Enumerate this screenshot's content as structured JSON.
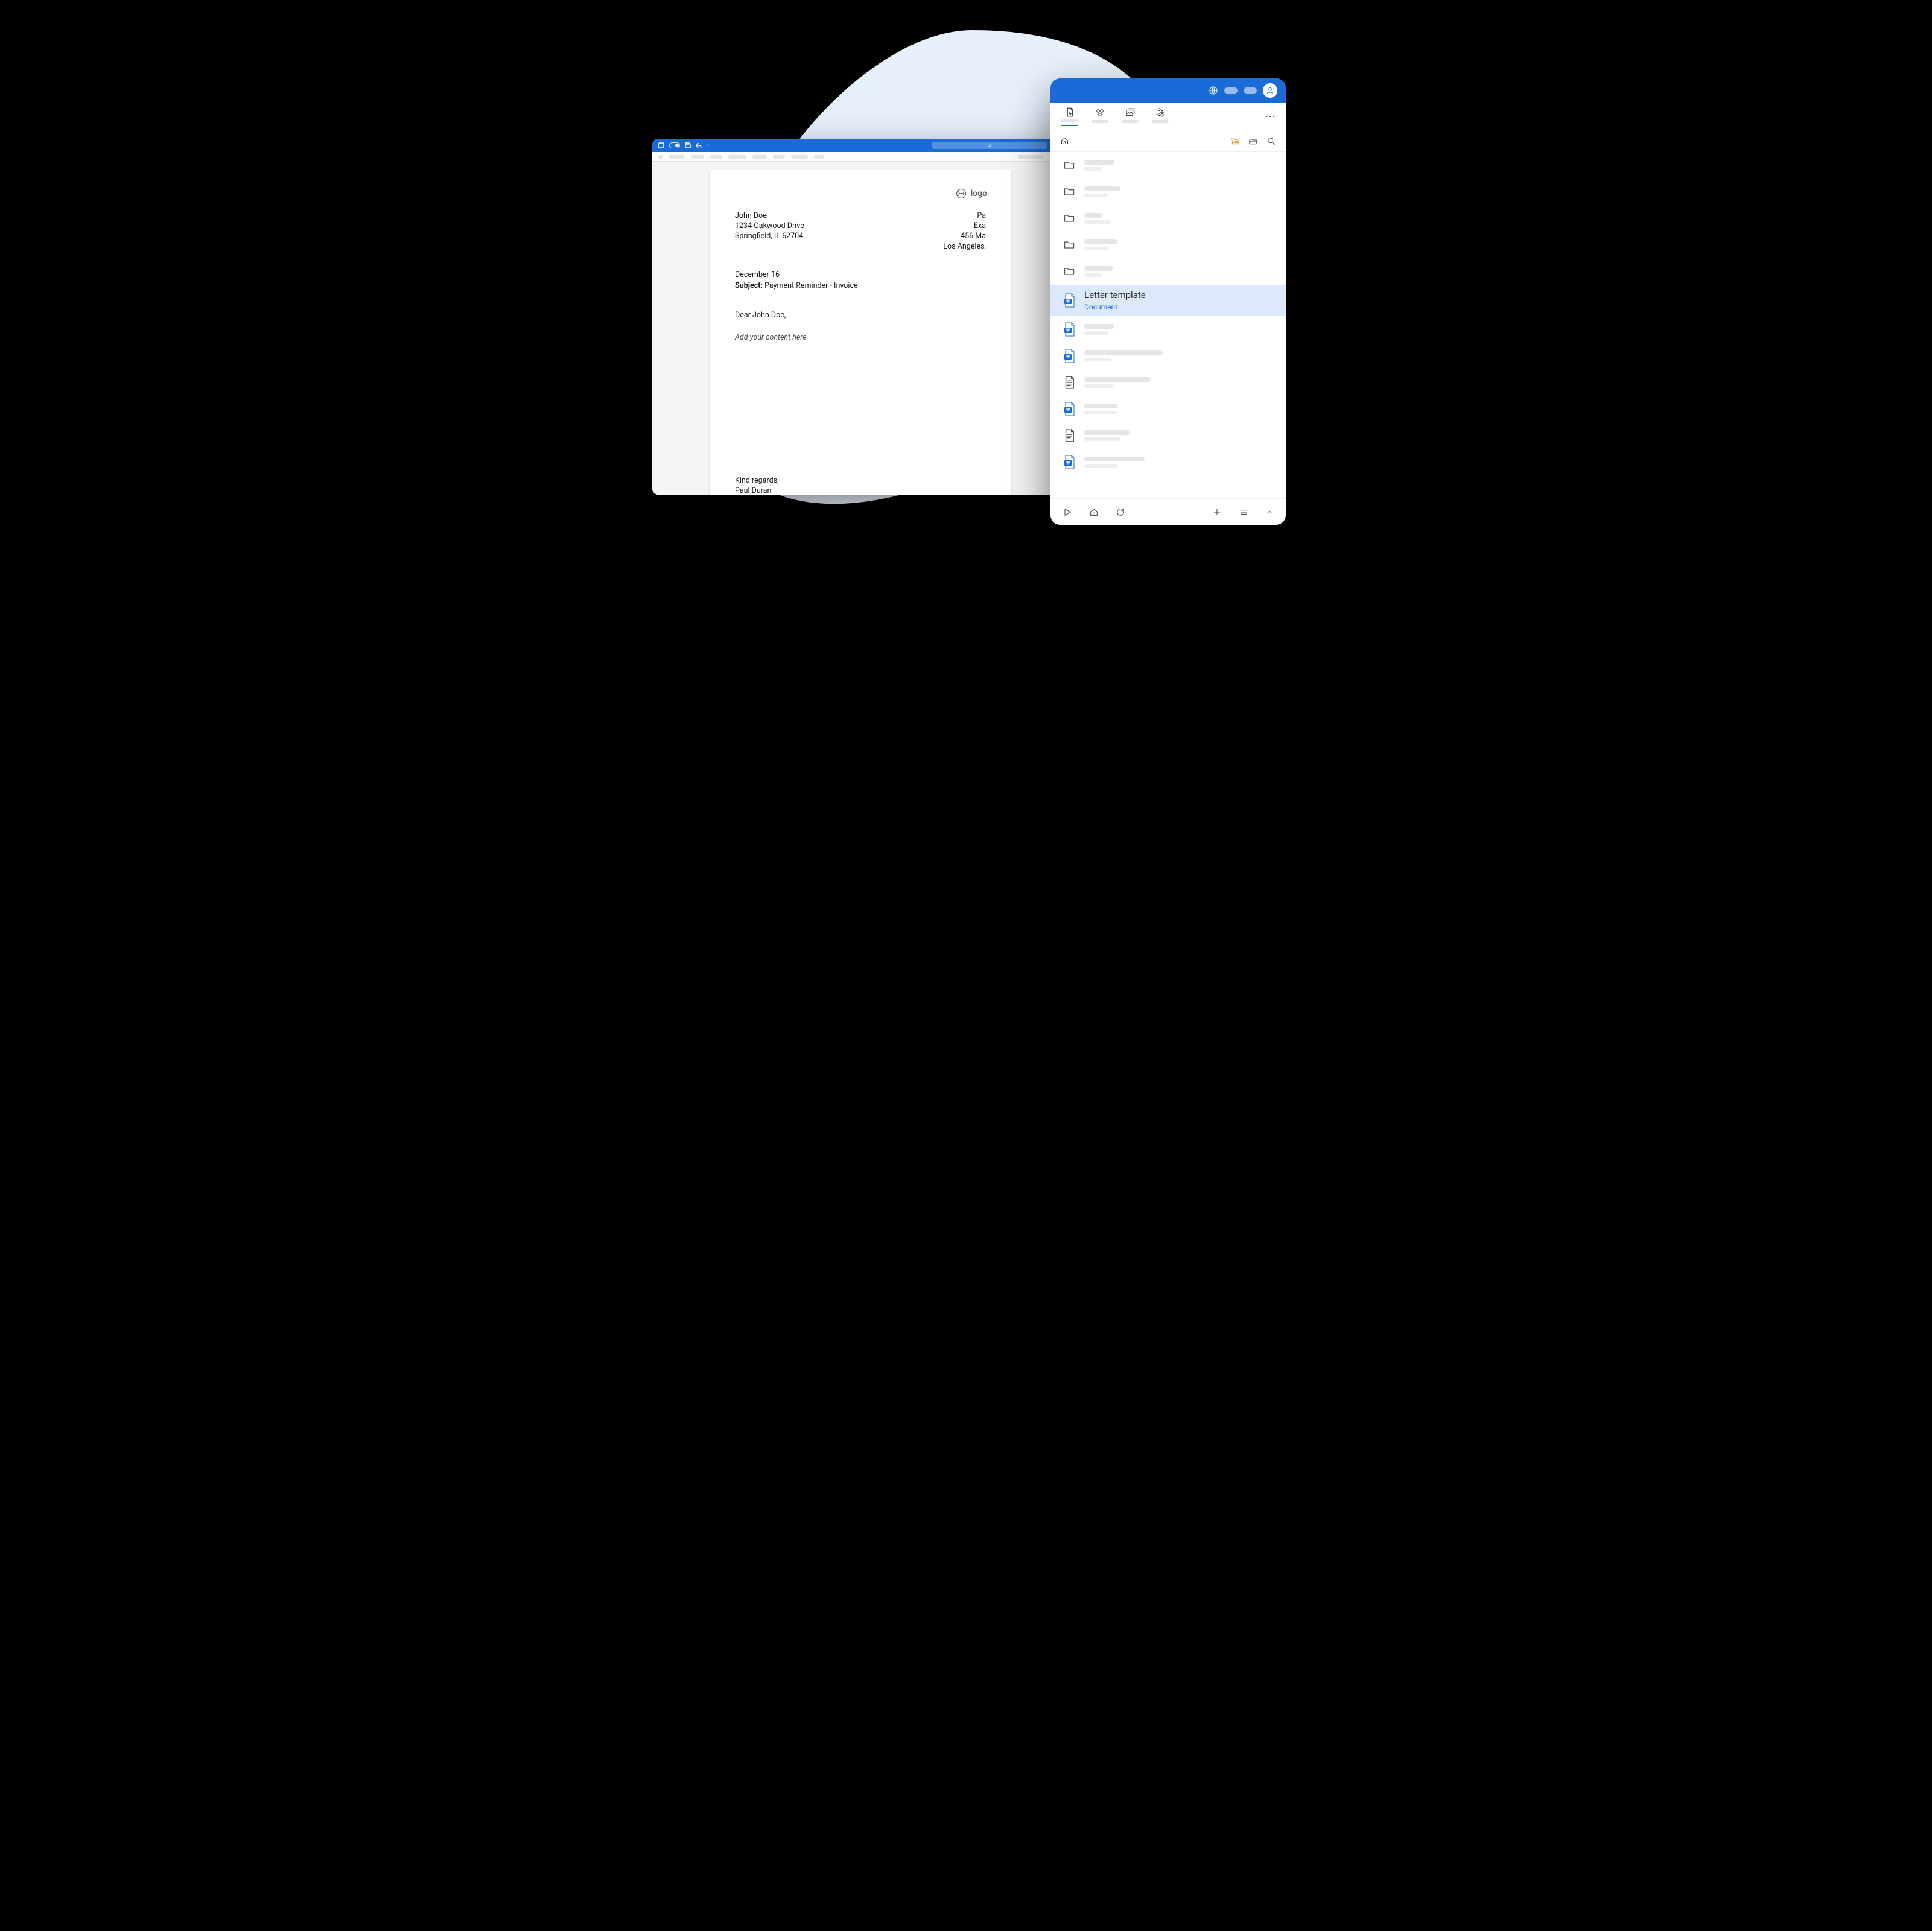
{
  "editor": {
    "logo_text": "logo",
    "from": {
      "name": "John Doe",
      "street": "1234 Oakwood Drive",
      "city": "Springfield, IL 62704"
    },
    "to": {
      "name": "Pa",
      "company": "Exa",
      "street": "456 Ma",
      "city": "Los Angeles,"
    },
    "date": "December 16",
    "subject_label": "Subject:",
    "subject_value": "Payment Reminder - Invoice",
    "greeting": "Dear John Doe,",
    "body_placeholder": "Add your content here",
    "signoff": "Kind regards,",
    "signer": "Paul Duran"
  },
  "panel": {
    "selected": {
      "title": "Letter template",
      "subtitle": "Document"
    }
  },
  "colors": {
    "brand": "#1a6bd8",
    "blob": "#e8f0fb",
    "selection": "#dce9fb",
    "accent_orange": "#e59a3f"
  }
}
